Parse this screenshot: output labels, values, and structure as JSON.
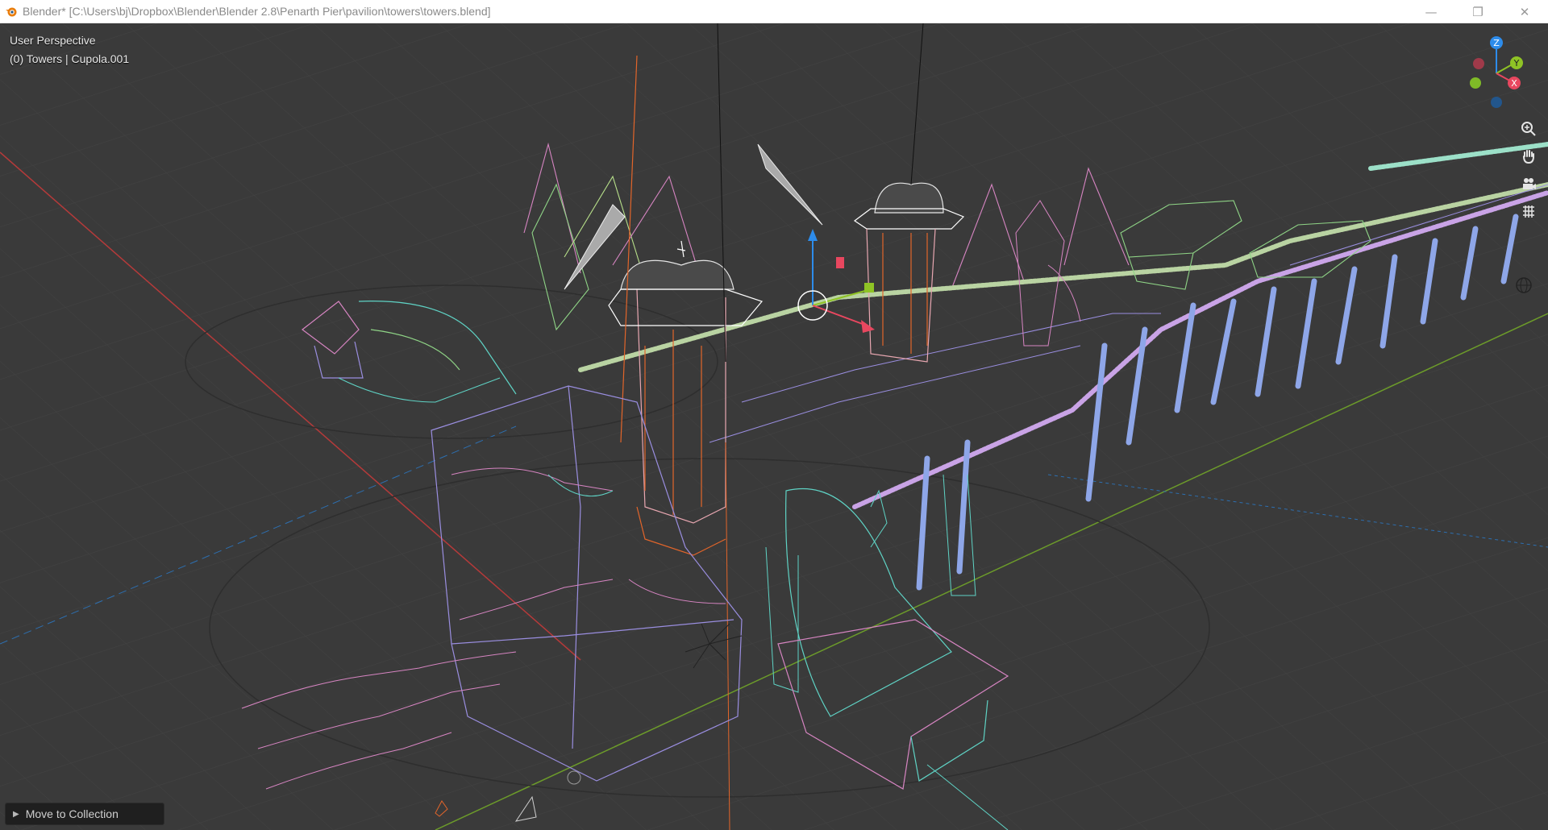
{
  "window": {
    "title": "Blender* [C:\\Users\\bj\\Dropbox\\Blender\\Blender 2.8\\Penarth Pier\\pavilion\\towers\\towers.blend]",
    "minimize_glyph": "—",
    "maximize_glyph": "❐",
    "close_glyph": "✕"
  },
  "viewport": {
    "view_name": "User Perspective",
    "object_info": "(0) Towers | Cupola.001"
  },
  "gizmo": {
    "z_label": "Z",
    "y_label": "Y",
    "x_label": "X",
    "colors": {
      "x": "#e8475f",
      "y": "#8fc325",
      "z": "#2d8ceb",
      "bg": "#3a3a3a"
    }
  },
  "nav_tools": [
    "zoom-icon",
    "pan-hand-icon",
    "camera-view-icon",
    "ortho-grid-icon"
  ],
  "operator_panel": {
    "label": "Move to Collection"
  },
  "colors": {
    "wire_pink": "#d785c2",
    "wire_purple": "#9a8ee0",
    "wire_cyan": "#5fd3c5",
    "wire_green": "#8fd486",
    "wire_orange": "#e2652a",
    "wire_blue": "#8ea6e8",
    "axis_x": "#b53a3a",
    "axis_y": "#6c9b2a"
  }
}
